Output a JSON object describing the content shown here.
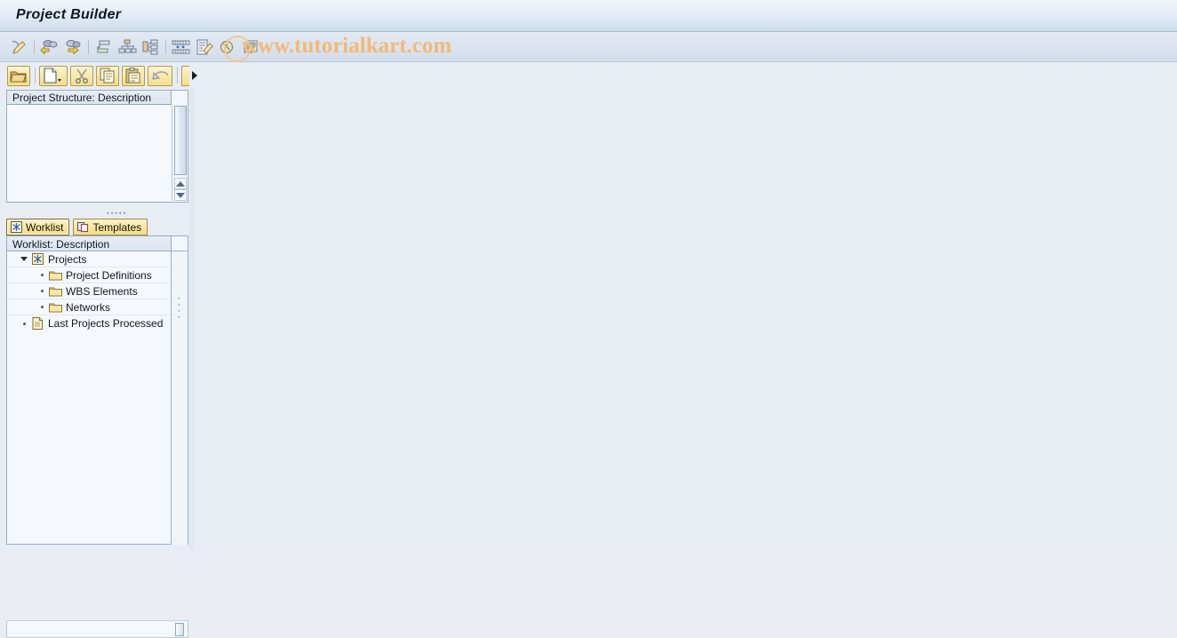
{
  "window": {
    "title": "Project Builder"
  },
  "watermark": {
    "text": "www.tutorialkart.com"
  },
  "function_toolbar": {
    "buttons": [
      {
        "name": "check-pencil-icon",
        "label": ""
      },
      {
        "name": "previous-object-icon",
        "label": ""
      },
      {
        "name": "next-object-icon",
        "label": ""
      },
      {
        "name": "hierarchy-graphic-icon",
        "label": ""
      },
      {
        "name": "structure-graphic-icon",
        "label": ""
      },
      {
        "name": "network-graphic-icon",
        "label": ""
      },
      {
        "name": "gantt-chart-icon",
        "label": ""
      },
      {
        "name": "confirmation-icon",
        "label": ""
      },
      {
        "name": "period-icon",
        "label": ""
      },
      {
        "name": "documents-icon",
        "label": ""
      }
    ]
  },
  "application_toolbar": {
    "buttons": [
      {
        "name": "open-project-icon",
        "label": ""
      },
      {
        "name": "create-new-icon",
        "label": ""
      },
      {
        "name": "cut-icon",
        "label": ""
      },
      {
        "name": "copy-icon",
        "label": ""
      },
      {
        "name": "paste-icon",
        "label": ""
      },
      {
        "name": "undo-icon",
        "label": ""
      }
    ],
    "overflow_label": ""
  },
  "project_structure": {
    "header": "Project Structure: Description",
    "rows": []
  },
  "tabs": [
    {
      "label": "Worklist",
      "icon": "worklist-icon",
      "selected": true
    },
    {
      "label": "Templates",
      "icon": "templates-icon",
      "selected": false
    }
  ],
  "worklist": {
    "header": "Worklist: Description",
    "tree": [
      {
        "label": "Projects",
        "icon": "projects-icon",
        "level": 0,
        "expanded": true,
        "toggle": "down"
      },
      {
        "label": "Project Definitions",
        "icon": "folder-icon",
        "level": 1,
        "expanded": false,
        "toggle": "bullet"
      },
      {
        "label": "WBS Elements",
        "icon": "folder-icon",
        "level": 1,
        "expanded": false,
        "toggle": "bullet"
      },
      {
        "label": "Networks",
        "icon": "folder-icon",
        "level": 1,
        "expanded": false,
        "toggle": "bullet"
      },
      {
        "label": "Last Projects Processed",
        "icon": "document-icon",
        "level": 0,
        "expanded": false,
        "toggle": "bullet"
      }
    ]
  },
  "colors": {
    "title_bar_top": "#f2f6fb",
    "title_bar_bottom": "#ccdbeb",
    "toolbar_bg": "#dae3ee",
    "app_bg": "#e8edf4",
    "panel_bg": "#f5f8fc",
    "panel_border": "#98aec4",
    "tab_yellow": "#f8e7a2",
    "folder_yellow": "#f2d98a",
    "watermark_orange": "#f0b978"
  }
}
